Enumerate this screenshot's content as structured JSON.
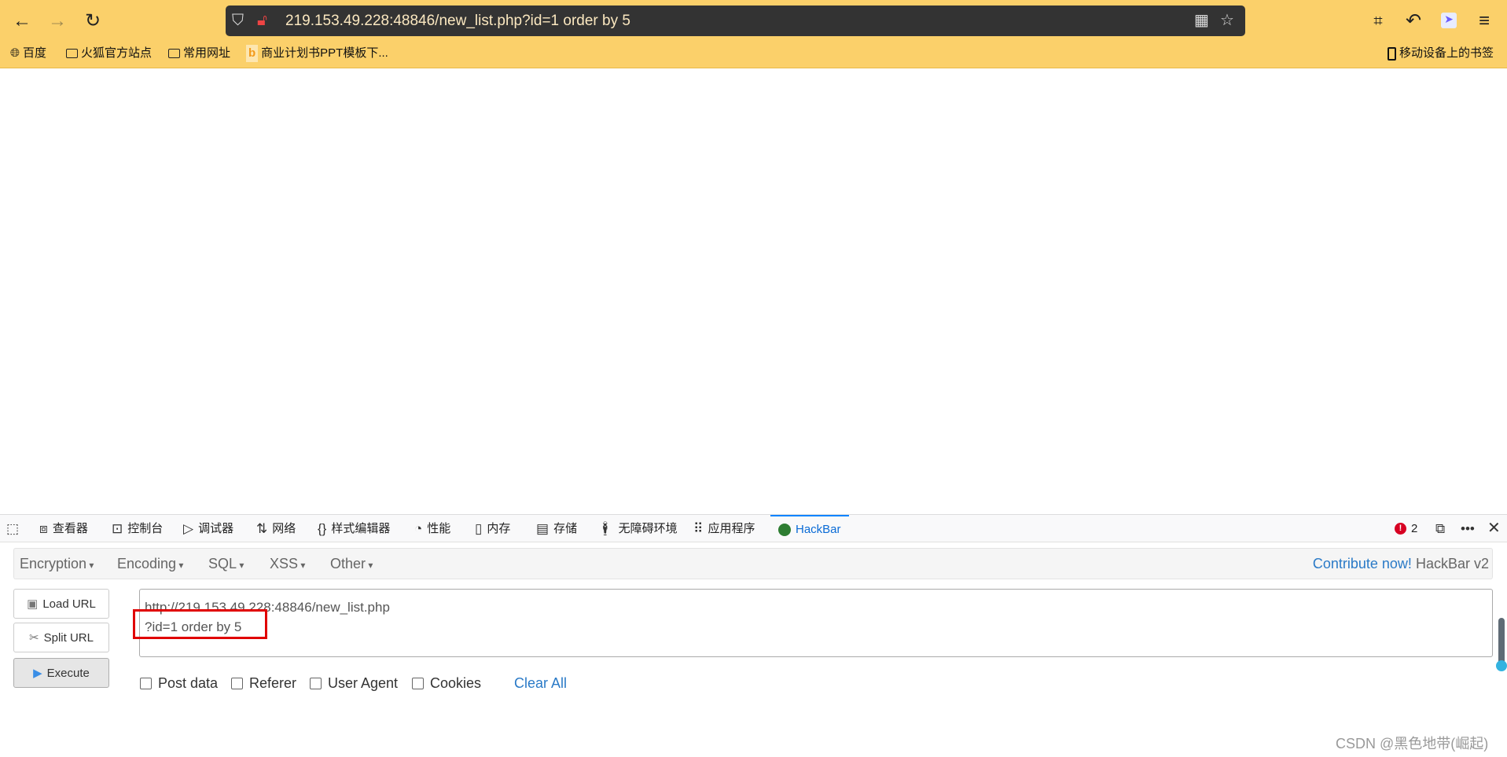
{
  "browser": {
    "url": "219.153.49.228:48846/new_list.php?id=1 order by 5",
    "bookmarks": [
      "百度",
      "火狐官方站点",
      "常用网址",
      "商业计划书PPT模板下..."
    ],
    "mobile_bookmarks": "移动设备上的书签"
  },
  "devtools": {
    "tabs": [
      "查看器",
      "控制台",
      "调试器",
      "网络",
      "样式编辑器",
      "性能",
      "内存",
      "存储",
      "无障碍环境",
      "应用程序",
      "HackBar"
    ],
    "error_count": "2"
  },
  "hackbar": {
    "menus": [
      "Encryption",
      "Encoding",
      "SQL",
      "XSS",
      "Other"
    ],
    "contribute": "Contribute now!",
    "version": "HackBar v2",
    "buttons": {
      "load": "Load URL",
      "split": "Split URL",
      "execute": "Execute"
    },
    "url_lines": [
      "http://219.153.49.228:48846/new_list.php",
      "?id=1 order by 5"
    ],
    "options": [
      "Post data",
      "Referer",
      "User Agent",
      "Cookies"
    ],
    "clear_all": "Clear All"
  },
  "watermark": "CSDN @黑色地带(崛起)"
}
